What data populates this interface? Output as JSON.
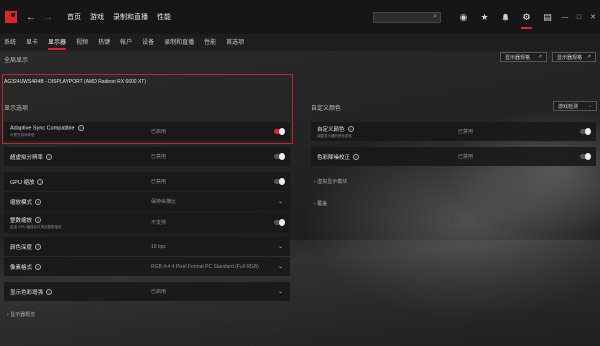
{
  "titlebar": {
    "back_arrow": "←",
    "forward_arrow": "→",
    "tabs": [
      "首页",
      "游戏",
      "录制和直播",
      "性能"
    ],
    "search_icon": "⌕",
    "icons": {
      "globe": "◉",
      "star": "★",
      "bell": "🔔",
      "gear": "⚙",
      "menu": "▤"
    },
    "window_controls": {
      "minimize": "—",
      "maximize": "□",
      "close": "✕"
    }
  },
  "subnav": {
    "tabs": [
      "系统",
      "显卡",
      "显示器",
      "视频",
      "热键",
      "帐户",
      "设备",
      "录制和直播",
      "性能",
      "首选项"
    ],
    "active_index": 2
  },
  "page": {
    "global_display_label": "全局显示",
    "monitor_name": "AG324UWS4R4B - DISPLAYPORT (AMD Radeon RX 6600 XT)",
    "display_options_label": "显示选项",
    "custom_color_label": "自定义颜色",
    "btn_top_1": "显示器规格",
    "btn_top_2": "显示器规格",
    "btn_reset": "游戏检测"
  },
  "left_rows": [
    {
      "label": "Adaptive Sync Compatible",
      "sub": "可提升游戏体验",
      "value": "已启用",
      "control": "toggle-on"
    },
    {
      "label": "超虚拟分辨率",
      "sub": "",
      "value": "已禁用",
      "control": "toggle-off"
    },
    {
      "label": "GPU 缩放",
      "sub": "",
      "value": "已禁用",
      "control": "toggle-off"
    },
    {
      "label": "缩放模式",
      "sub": "",
      "value": "保持纵横比",
      "control": "chevron"
    },
    {
      "label": "整数缩放",
      "sub": "启用 GPU 缩放后可用此整数缩放",
      "value": "不支持",
      "control": "toggle-off"
    },
    {
      "label": "颜色深度",
      "sub": "",
      "value": "10 bpc",
      "control": "chevron"
    },
    {
      "label": "像素格式",
      "sub": "",
      "value": "RGB 4:4:4 Pixel Format PC Standard (Full RGB)",
      "control": "chevron"
    },
    {
      "label": "显示色彩增强",
      "sub": "",
      "value": "已启用",
      "control": "chevron"
    }
  ],
  "right_rows": [
    {
      "label": "自定义颜色",
      "sub": "调整显示器的颜色属性",
      "value": "已禁用",
      "control": "toggle-off"
    },
    {
      "label": "色彩降噪校正",
      "sub": "",
      "value": "已禁用",
      "control": "toggle-off"
    }
  ],
  "expanders": {
    "left_bottom": "显示器概览",
    "right_1": "虚拟显示模块",
    "right_2": "覆盖"
  },
  "colors": {
    "accent": "#e4202c",
    "row_bg": "#181818"
  }
}
